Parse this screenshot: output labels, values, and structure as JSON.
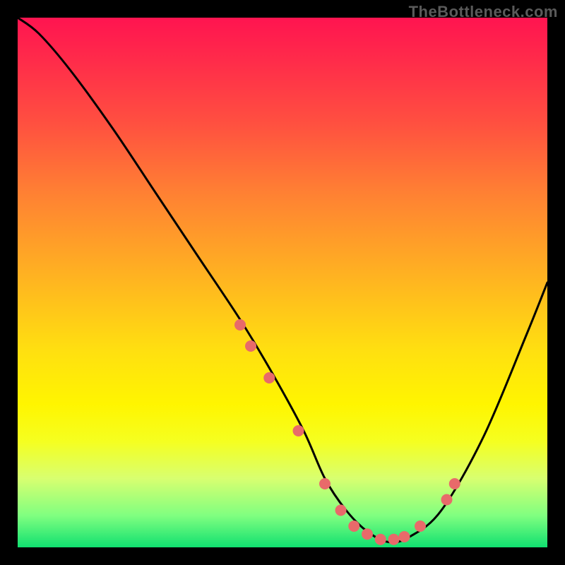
{
  "attribution": "TheBottleneck.com",
  "chart_data": {
    "type": "line",
    "title": "",
    "xlabel": "",
    "ylabel": "",
    "xlim": [
      0,
      100
    ],
    "ylim": [
      0,
      100
    ],
    "grid": false,
    "legend": false,
    "series": [
      {
        "name": "bottleneck-curve",
        "x": [
          0,
          4,
          10,
          18,
          26,
          34,
          42,
          48,
          54,
          58,
          62,
          66,
          70,
          74,
          80,
          88,
          96,
          100
        ],
        "y": [
          100,
          97,
          90,
          79,
          67,
          55,
          43,
          33,
          22,
          13,
          7,
          3,
          1,
          2,
          7,
          21,
          40,
          50
        ]
      }
    ],
    "markers": {
      "name": "highlight-points",
      "x": [
        42,
        44,
        47.5,
        53,
        58,
        61,
        63.5,
        66,
        68.5,
        71,
        73,
        76,
        81,
        82.5
      ],
      "y": [
        42,
        38,
        32,
        22,
        12,
        7,
        4,
        2.5,
        1.5,
        1.5,
        2,
        4,
        9,
        12
      ]
    },
    "gradient_stops": [
      {
        "pos": 0.0,
        "color": "#ff1450"
      },
      {
        "pos": 0.2,
        "color": "#ff5040"
      },
      {
        "pos": 0.48,
        "color": "#ffb022"
      },
      {
        "pos": 0.73,
        "color": "#fff500"
      },
      {
        "pos": 0.94,
        "color": "#80ff80"
      },
      {
        "pos": 1.0,
        "color": "#10e070"
      }
    ]
  }
}
